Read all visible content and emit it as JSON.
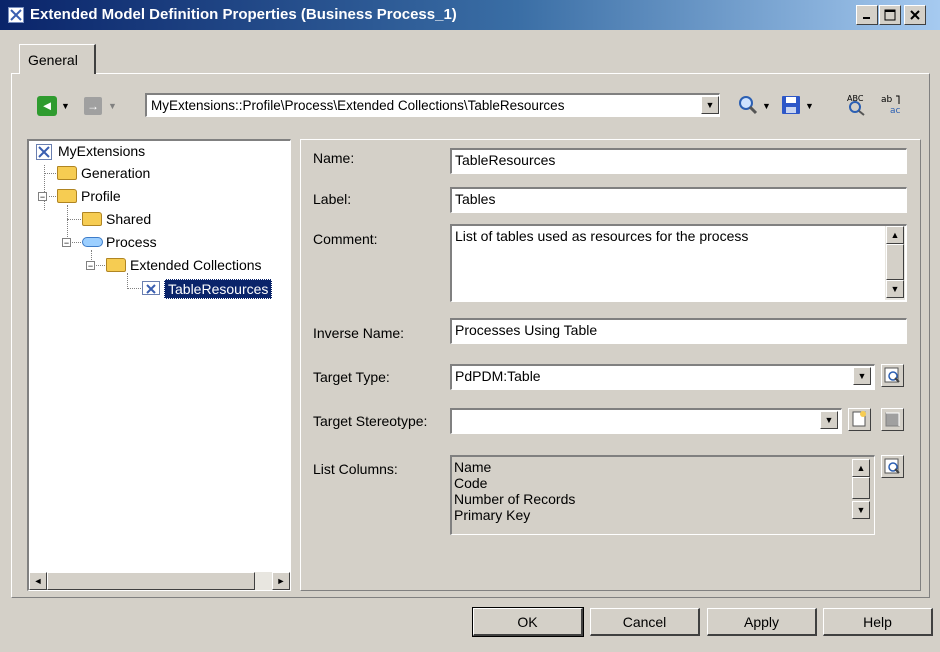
{
  "window": {
    "title": "Extended Model Definition Properties (Business Process_1)"
  },
  "tabs": [
    {
      "label": "General",
      "active": true
    }
  ],
  "toolbar": {
    "path": "MyExtensions::Profile\\Process\\Extended Collections\\TableResources",
    "icons": [
      "back-arrow-icon",
      "forward-arrow-icon",
      "find-icon",
      "save-icon",
      "spell-check-icon",
      "replace-text-icon"
    ]
  },
  "tree": {
    "root": "MyExtensions",
    "generation": "Generation",
    "profile": "Profile",
    "shared": "Shared",
    "process": "Process",
    "extended_collections": "Extended Collections",
    "table_resources": "TableResources"
  },
  "form": {
    "name": {
      "label": "Name:",
      "value": "TableResources"
    },
    "label": {
      "label": "Label:",
      "value": "Tables"
    },
    "comment": {
      "label": "Comment:",
      "value": "List of tables used as resources for the process"
    },
    "inverse_name": {
      "label": "Inverse Name:",
      "value": "Processes Using Table"
    },
    "target_type": {
      "label": "Target Type:",
      "value": "PdPDM:Table"
    },
    "target_stereotype": {
      "label": "Target Stereotype:",
      "value": ""
    },
    "list_columns": {
      "label": "List Columns:",
      "items": [
        "Name",
        "Code",
        "Number of Records",
        "Primary Key"
      ]
    }
  },
  "buttons": {
    "ok": "OK",
    "cancel": "Cancel",
    "apply": "Apply",
    "help": "Help"
  },
  "colors": {
    "titlebar_start": "#0a246a",
    "titlebar_end": "#a6caf0",
    "selection": "#0a246a",
    "dialog_bg": "#d4d0c8"
  }
}
